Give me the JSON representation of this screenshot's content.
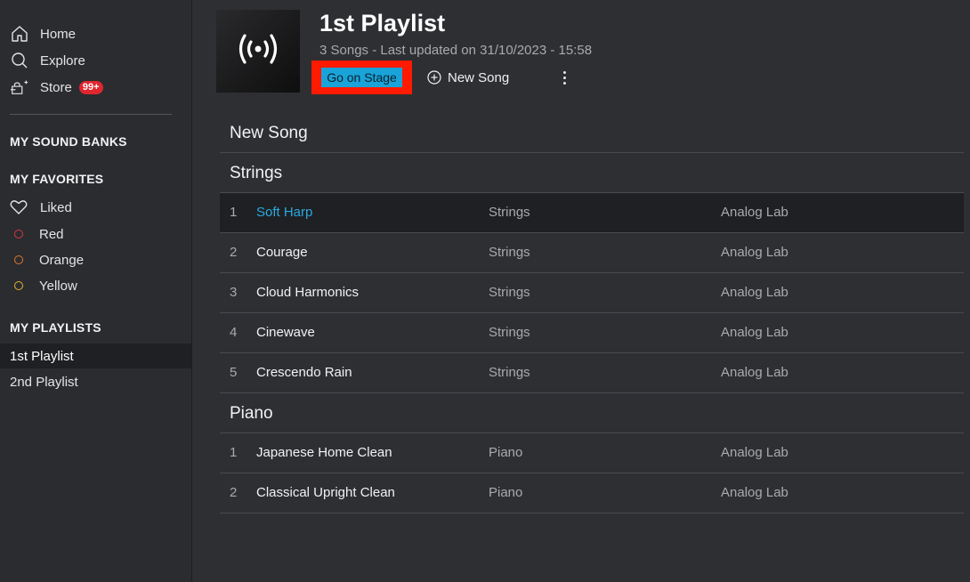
{
  "sidebar": {
    "nav": [
      {
        "label": "Home",
        "icon": "home-icon"
      },
      {
        "label": "Explore",
        "icon": "search-icon"
      },
      {
        "label": "Store",
        "icon": "store-icon",
        "badge": "99+"
      }
    ],
    "sound_banks_heading": "MY SOUND BANKS",
    "favorites_heading": "MY FAVORITES",
    "favorites": [
      {
        "label": "Liked",
        "icon": "heart-icon"
      },
      {
        "label": "Red",
        "color": "#d7373f"
      },
      {
        "label": "Orange",
        "color": "#e07a2a"
      },
      {
        "label": "Yellow",
        "color": "#e3b52b"
      }
    ],
    "playlists_heading": "MY PLAYLISTS",
    "playlists": [
      {
        "label": "1st Playlist",
        "active": true
      },
      {
        "label": "2nd Playlist",
        "active": false
      }
    ]
  },
  "playlist": {
    "title": "1st Playlist",
    "subtitle": "3 Songs - Last updated on 31/10/2023 - 15:58",
    "go_on_stage": "Go on Stage",
    "new_song": "New Song"
  },
  "groups": [
    {
      "name": "New Song",
      "songs": []
    },
    {
      "name": "Strings",
      "songs": [
        {
          "num": "1",
          "name": "Soft Harp",
          "category": "Strings",
          "bank": "Analog Lab",
          "selected": true
        },
        {
          "num": "2",
          "name": "Courage",
          "category": "Strings",
          "bank": "Analog Lab"
        },
        {
          "num": "3",
          "name": "Cloud Harmonics",
          "category": "Strings",
          "bank": "Analog Lab"
        },
        {
          "num": "4",
          "name": "Cinewave",
          "category": "Strings",
          "bank": "Analog Lab"
        },
        {
          "num": "5",
          "name": "Crescendo Rain",
          "category": "Strings",
          "bank": "Analog Lab"
        }
      ]
    },
    {
      "name": "Piano",
      "songs": [
        {
          "num": "1",
          "name": "Japanese Home Clean",
          "category": "Piano",
          "bank": "Analog Lab"
        },
        {
          "num": "2",
          "name": "Classical Upright Clean",
          "category": "Piano",
          "bank": "Analog Lab"
        }
      ]
    }
  ],
  "colors": {
    "accent": "#1aa3d9",
    "highlight": "#ff1a00",
    "selected_text": "#29a9e0"
  }
}
